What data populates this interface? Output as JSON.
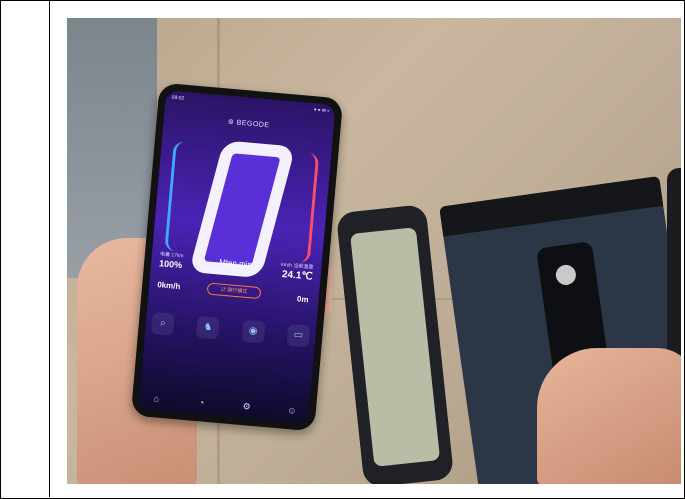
{
  "phone_app": {
    "status_time": "09:02",
    "status_icons": "▾ ▾ ✉ ▪",
    "brand": "⊚ BEGODE",
    "model": "Mten mini",
    "battery_label": "电量 17km",
    "battery_value": "100%",
    "temp_label": "km/h 当前温度",
    "temp_value": "24.1℃",
    "speed_value": "0km/h",
    "mileage_value": "0m",
    "mode_label": "⇄ 骑行模式",
    "icons": [
      "search-icon",
      "scooter-icon",
      "camera-icon",
      "battery-icon"
    ],
    "nav_icons": [
      "home-icon",
      "record-icon",
      "settings-icon",
      "profile-icon"
    ],
    "accent_blue": "#3fa9ff",
    "accent_red": "#ff4d6a"
  }
}
